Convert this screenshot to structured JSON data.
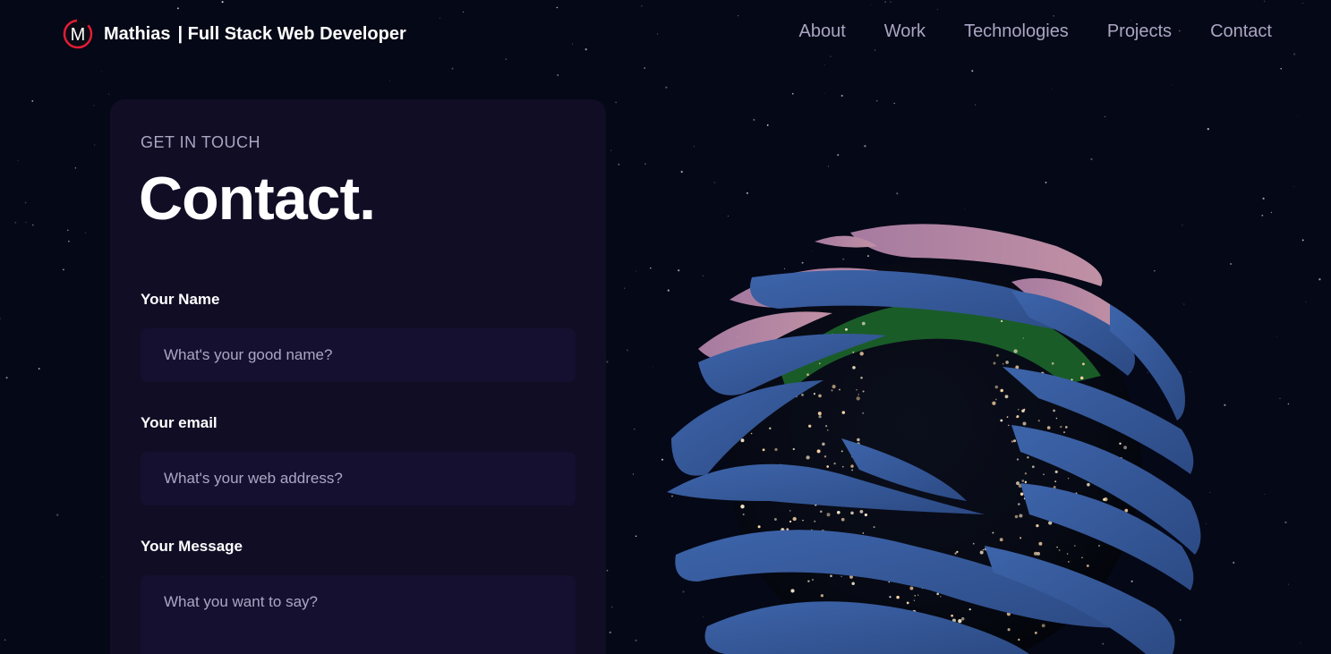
{
  "header": {
    "logo_letter": "M",
    "brand_name": "Mathias",
    "brand_tagline": "| Full Stack Web Developer",
    "nav": [
      {
        "label": "About"
      },
      {
        "label": "Work"
      },
      {
        "label": "Technologies"
      },
      {
        "label": "Projects"
      },
      {
        "label": "Contact"
      }
    ]
  },
  "contact": {
    "eyebrow": "GET IN TOUCH",
    "title": "Contact.",
    "fields": {
      "name": {
        "label": "Your Name",
        "placeholder": "What's your good name?",
        "value": ""
      },
      "email": {
        "label": "Your email",
        "placeholder": "What's your web address?",
        "value": ""
      },
      "message": {
        "label": "Your Message",
        "placeholder": "What you want to say?",
        "value": ""
      }
    }
  },
  "colors": {
    "background": "#050816",
    "card": "#100d25",
    "input": "#151030",
    "secondary_text": "#aaa6c3",
    "logo_accent": "#e11d35",
    "globe_bands": "#35579a",
    "globe_pink": "#c78aa6"
  },
  "icons": {
    "logo": "m-monogram-logo",
    "globe": "earth-3d-globe"
  }
}
